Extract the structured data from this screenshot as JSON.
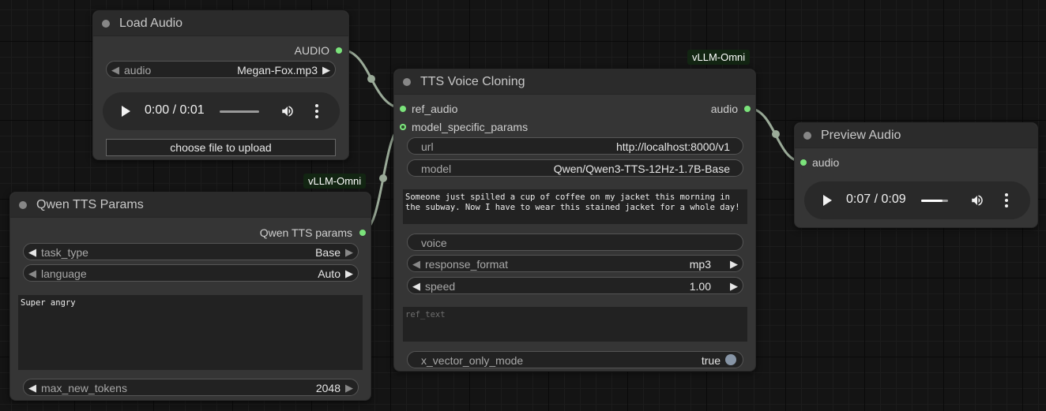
{
  "nodes": {
    "load_audio": {
      "title": "Load Audio",
      "output_label": "AUDIO",
      "audio_widget": {
        "label": "audio",
        "value": "Megan-Fox.mp3"
      },
      "player": {
        "time": "0:00 / 0:01",
        "progress": 0.0
      },
      "upload_label": "choose file to upload"
    },
    "qwen_params": {
      "badge": "vLLM-Omni",
      "title": "Qwen TTS Params",
      "output_label": "Qwen TTS params",
      "task_type": {
        "label": "task_type",
        "value": "Base"
      },
      "language": {
        "label": "language",
        "value": "Auto"
      },
      "instructions": "Super angry",
      "max_new_tokens": {
        "label": "max_new_tokens",
        "value": "2048"
      }
    },
    "tts_clone": {
      "badge": "vLLM-Omni",
      "title": "TTS Voice Cloning",
      "inputs": [
        "ref_audio",
        "model_specific_params"
      ],
      "output_label": "audio",
      "url": {
        "label": "url",
        "value": "http://localhost:8000/v1"
      },
      "model": {
        "label": "model",
        "value": "Qwen/Qwen3-TTS-12Hz-1.7B-Base"
      },
      "text": "Someone just spilled a cup of coffee on my jacket this morning in the subway. Now I have to wear this stained jacket for a whole day!",
      "voice": {
        "label": "voice"
      },
      "response_format": {
        "label": "response_format",
        "value": "mp3"
      },
      "speed": {
        "label": "speed",
        "value": "1.00"
      },
      "ref_text_placeholder": "ref_text",
      "x_vector": {
        "label": "x_vector_only_mode",
        "value": "true"
      }
    },
    "preview_audio": {
      "title": "Preview Audio",
      "input_label": "audio",
      "player": {
        "time": "0:07 / 0:09",
        "progress": 0.78
      }
    }
  },
  "icons": {
    "play": "play-icon",
    "volume": "volume-icon",
    "more": "more-vert-icon",
    "arrow_left": "◀",
    "arrow_right": "▶"
  },
  "colors": {
    "slot_green": "#7be37b",
    "link": "#9aaa98",
    "badge_bg": "#122512"
  }
}
